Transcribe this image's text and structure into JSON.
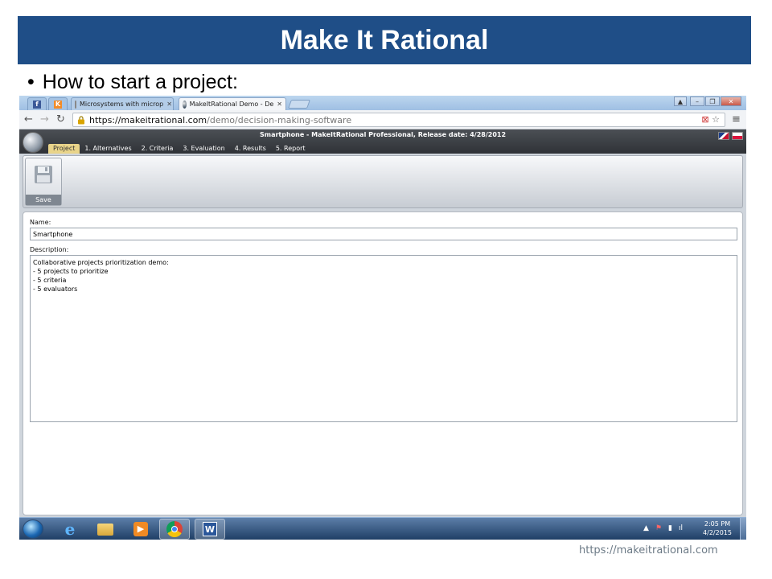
{
  "slide": {
    "title": "Make It Rational",
    "bullet": "How to start a project:",
    "source_url": "https://makeitrational.com"
  },
  "browser": {
    "tabs": [
      {
        "label": "",
        "icon": "facebook-icon"
      },
      {
        "label": "",
        "icon": "k-icon"
      },
      {
        "label": "Microsystems with microp",
        "icon": "document-icon"
      },
      {
        "label": "MakeItRational Demo - De",
        "icon": "makeitrational-icon",
        "active": true
      }
    ],
    "url_host": "https://makeitrational.com",
    "url_path": "/demo/decision-making-software"
  },
  "app": {
    "status": "Smartphone - MakeItRational Professional, Release date: 4/28/2012",
    "menu": [
      {
        "label": "Project",
        "active": true
      },
      {
        "label": "1. Alternatives"
      },
      {
        "label": "2. Criteria"
      },
      {
        "label": "3. Evaluation"
      },
      {
        "label": "4. Results"
      },
      {
        "label": "5. Report"
      }
    ],
    "save_label": "Save",
    "name_label": "Name:",
    "name_value": "Smartphone",
    "description_label": "Description:",
    "description_value": "Collaborative projects prioritization demo:\n- 5 projects to prioritize\n- 5 criteria\n- 5 evaluators"
  },
  "taskbar": {
    "time": "2:05 PM",
    "date": "4/2/2015",
    "apps": [
      "ie-icon",
      "folder-icon",
      "media-player-icon",
      "chrome-icon",
      "word-icon"
    ]
  },
  "colors": {
    "slide_title_bg": "#1f4e87",
    "active_menu": "#e9d48a"
  }
}
